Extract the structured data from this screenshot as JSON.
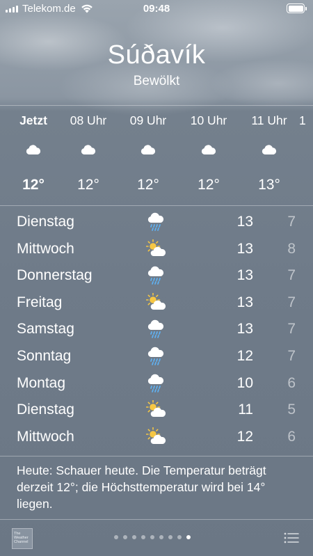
{
  "status_bar": {
    "carrier": "Telekom.de",
    "time": "09:48"
  },
  "location": {
    "city": "Súðavík",
    "condition": "Bewölkt"
  },
  "hourly": [
    {
      "label": "Jetzt",
      "icon": "cloud-icon",
      "temp": "12°"
    },
    {
      "label": "08 Uhr",
      "icon": "cloud-icon",
      "temp": "12°"
    },
    {
      "label": "09 Uhr",
      "icon": "cloud-icon",
      "temp": "12°"
    },
    {
      "label": "10 Uhr",
      "icon": "cloud-icon",
      "temp": "12°"
    },
    {
      "label": "11 Uhr",
      "icon": "cloud-icon",
      "temp": "13°"
    },
    {
      "label": "1",
      "icon": "",
      "temp": ""
    }
  ],
  "daily": [
    {
      "day": "Dienstag",
      "icon": "rain-cloud-icon",
      "high": "13",
      "low": "7"
    },
    {
      "day": "Mittwoch",
      "icon": "partly-sunny-icon",
      "high": "13",
      "low": "8"
    },
    {
      "day": "Donnerstag",
      "icon": "rain-cloud-icon",
      "high": "13",
      "low": "7"
    },
    {
      "day": "Freitag",
      "icon": "partly-sunny-icon",
      "high": "13",
      "low": "7"
    },
    {
      "day": "Samstag",
      "icon": "rain-cloud-icon",
      "high": "13",
      "low": "7"
    },
    {
      "day": "Sonntag",
      "icon": "rain-cloud-icon",
      "high": "12",
      "low": "7"
    },
    {
      "day": "Montag",
      "icon": "rain-cloud-icon",
      "high": "10",
      "low": "6"
    },
    {
      "day": "Dienstag",
      "icon": "partly-sunny-icon",
      "high": "11",
      "low": "5"
    },
    {
      "day": "Mittwoch",
      "icon": "partly-sunny-icon",
      "high": "12",
      "low": "6"
    }
  ],
  "summary": "Heute: Schauer heute. Die Temperatur beträgt derzeit 12°; die Höchsttemperatur wird bei 14° liegen.",
  "footer": {
    "logo_line1": "The",
    "logo_line2": "Weather",
    "logo_line3": "Channel",
    "page_count": 9,
    "active_page": 9
  },
  "colors": {
    "sun": "#f6c744",
    "rain": "#5fb0f0",
    "cloud": "#ffffff"
  }
}
